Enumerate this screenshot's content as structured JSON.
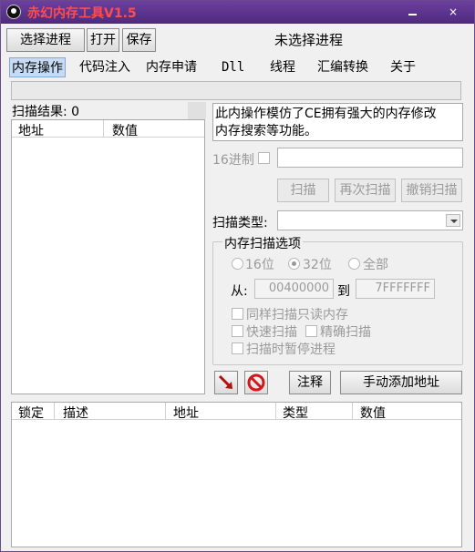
{
  "window": {
    "title": "赤幻内存工具V1.5",
    "close_glyph": "×"
  },
  "toolbar": {
    "select_process": "选择进程",
    "open": "打开",
    "save": "保存",
    "status": "未选择进程"
  },
  "tabs": [
    {
      "label": "内存操作",
      "active": true
    },
    {
      "label": "代码注入"
    },
    {
      "label": "内存申请"
    },
    {
      "label": "Dll"
    },
    {
      "label": "线程"
    },
    {
      "label": "汇编转换"
    },
    {
      "label": "关于"
    }
  ],
  "scan": {
    "results_label": "扫描结果:",
    "results_count": "0",
    "columns": [
      "地址",
      "数值"
    ]
  },
  "info": {
    "line1": "此内操作模仿了CE拥有强大的内存修改",
    "line2": "内存搜索等功能。"
  },
  "search": {
    "hex_label": "16进制",
    "value": "",
    "scan_button": "扫描",
    "rescan_button": "再次扫描",
    "undo_button": "撤销扫描",
    "type_label": "扫描类型:",
    "type_value": ""
  },
  "options": {
    "title": "内存扫描选项",
    "bits16": "16位",
    "bits32": "32位",
    "all": "全部",
    "from_label": "从:",
    "from_value": "00400000",
    "to_label": "到",
    "to_value": "7FFFFFFF",
    "readonly_scan": "同样扫描只读内存",
    "fast_scan": "快速扫描",
    "precise_scan": "精确扫描",
    "pause_scan": "扫描时暂停进程"
  },
  "actions": {
    "comment": "注释",
    "add_address": "手动添加地址"
  },
  "address_list": {
    "columns": [
      "锁定",
      "描述",
      "地址",
      "类型",
      "数值"
    ]
  }
}
